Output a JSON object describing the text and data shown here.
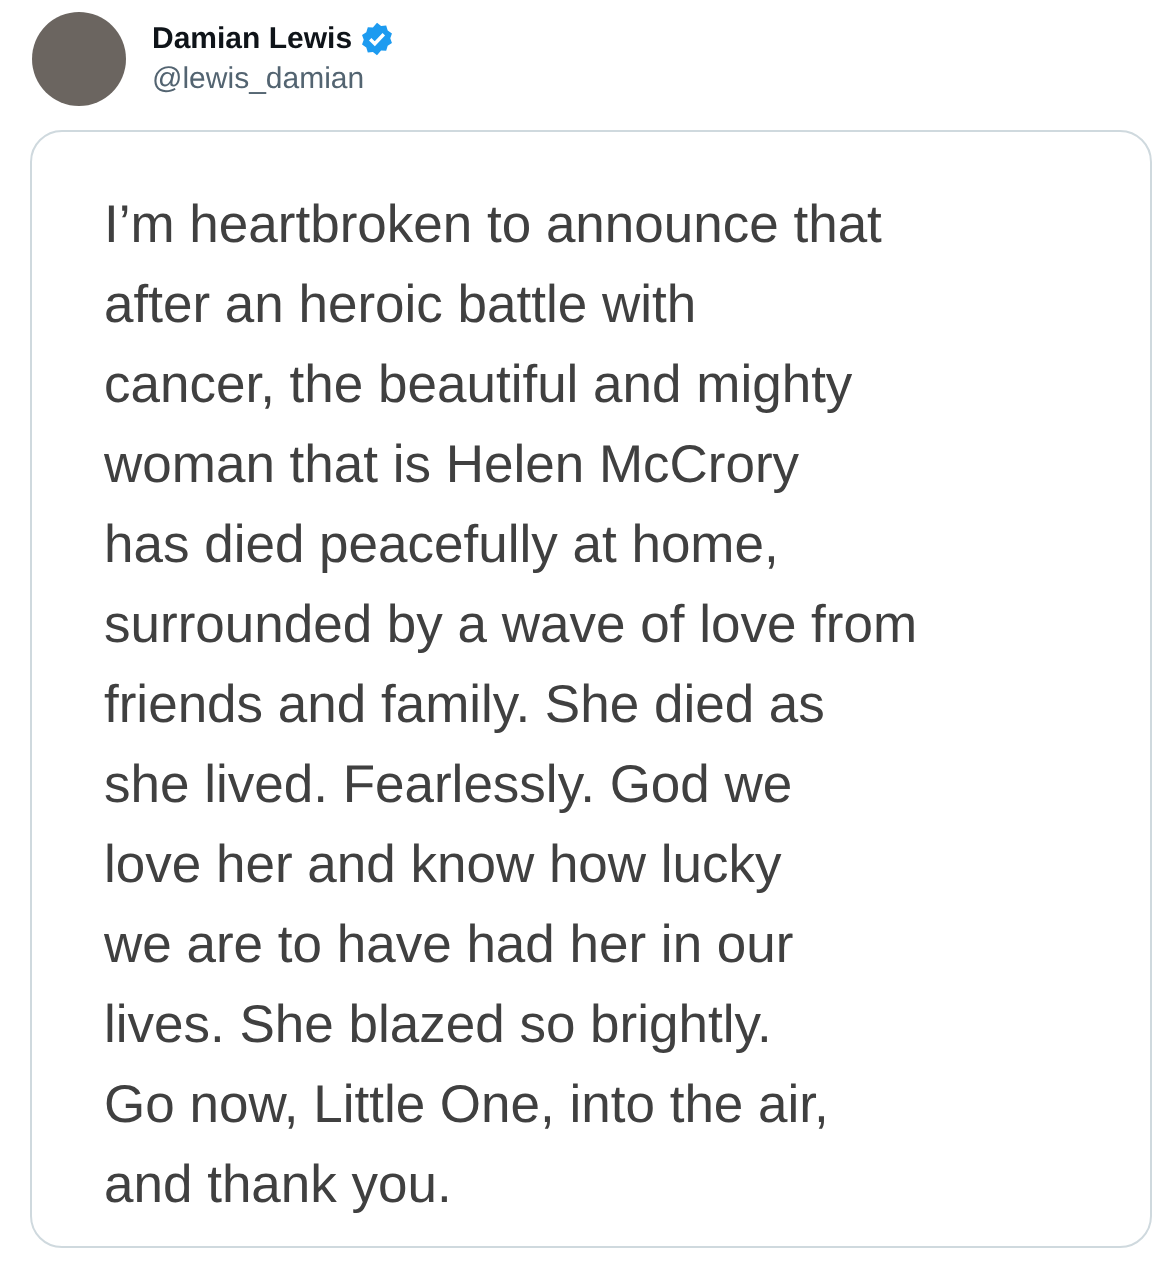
{
  "author": {
    "name": "Damian Lewis",
    "verified": true,
    "handle": "@lewis_damian"
  },
  "image_card": {
    "lines": [
      "I’m heartbroken to announce that",
      "after an heroic battle with",
      "cancer, the beautiful and mighty",
      "woman that is Helen McCrory",
      "has died peacefully at home,",
      "surrounded by a wave of love from",
      "friends and family. She died as",
      "she lived. Fearlessly. God we",
      "love her and know how lucky",
      "we are to have had her in our",
      "lives. She blazed so brightly.",
      "Go now, Little One, into the air,",
      "and thank you."
    ]
  }
}
